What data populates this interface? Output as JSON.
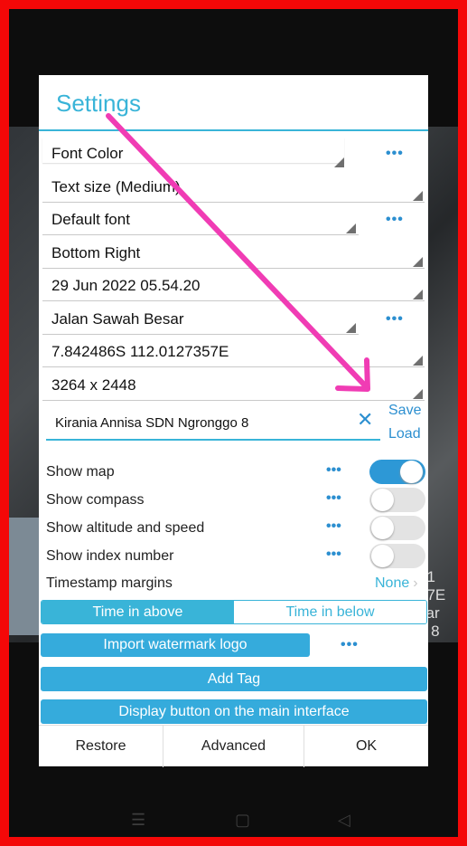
{
  "dialog": {
    "title": "Settings",
    "settings": [
      {
        "label": "Font Color",
        "dots": "•••"
      },
      {
        "label": "Text size (Medium)"
      },
      {
        "label": "Default font",
        "dots": "•••"
      },
      {
        "label": "Bottom Right"
      },
      {
        "label": "29 Jun 2022 05.54.20"
      },
      {
        "label": "Jalan Sawah Besar",
        "dots": "•••"
      },
      {
        "label": "7.842486S 112.0127357E"
      },
      {
        "label": "3264 x 2448"
      }
    ],
    "text_input": {
      "value": "Kirania Annisa SDN Ngronggo 8",
      "clear_icon": "close-icon"
    },
    "save_label": "Save",
    "load_label": "Load",
    "options": [
      {
        "label": "Show map",
        "dots": "•••",
        "enabled": true
      },
      {
        "label": "Show compass",
        "dots": "•••",
        "enabled": false
      },
      {
        "label": "Show altitude and speed",
        "dots": "•••",
        "enabled": false
      },
      {
        "label": "Show index number",
        "dots": "•••",
        "enabled": false
      }
    ],
    "timestamp_margins": {
      "label": "Timestamp margins",
      "value": "None",
      "chevron": "›"
    },
    "time_position": {
      "above": "Time in above",
      "below": "Time in below",
      "selected": "above"
    },
    "import_watermark_logo": "Import watermark logo",
    "import_dots": "•••",
    "add_tag": "Add Tag",
    "display_button": "Display button on the main interface",
    "footer": {
      "restore": "Restore",
      "advanced": "Advanced",
      "ok": "OK"
    }
  },
  "background": {
    "right_text": [
      "41",
      "57E",
      "sar",
      "o 8"
    ]
  },
  "nav": {
    "menu": "☰",
    "home": "▢",
    "back": "◁"
  },
  "colors": {
    "accent": "#39b4d8",
    "frame": "#f40808",
    "arrow": "#f03cb4"
  }
}
